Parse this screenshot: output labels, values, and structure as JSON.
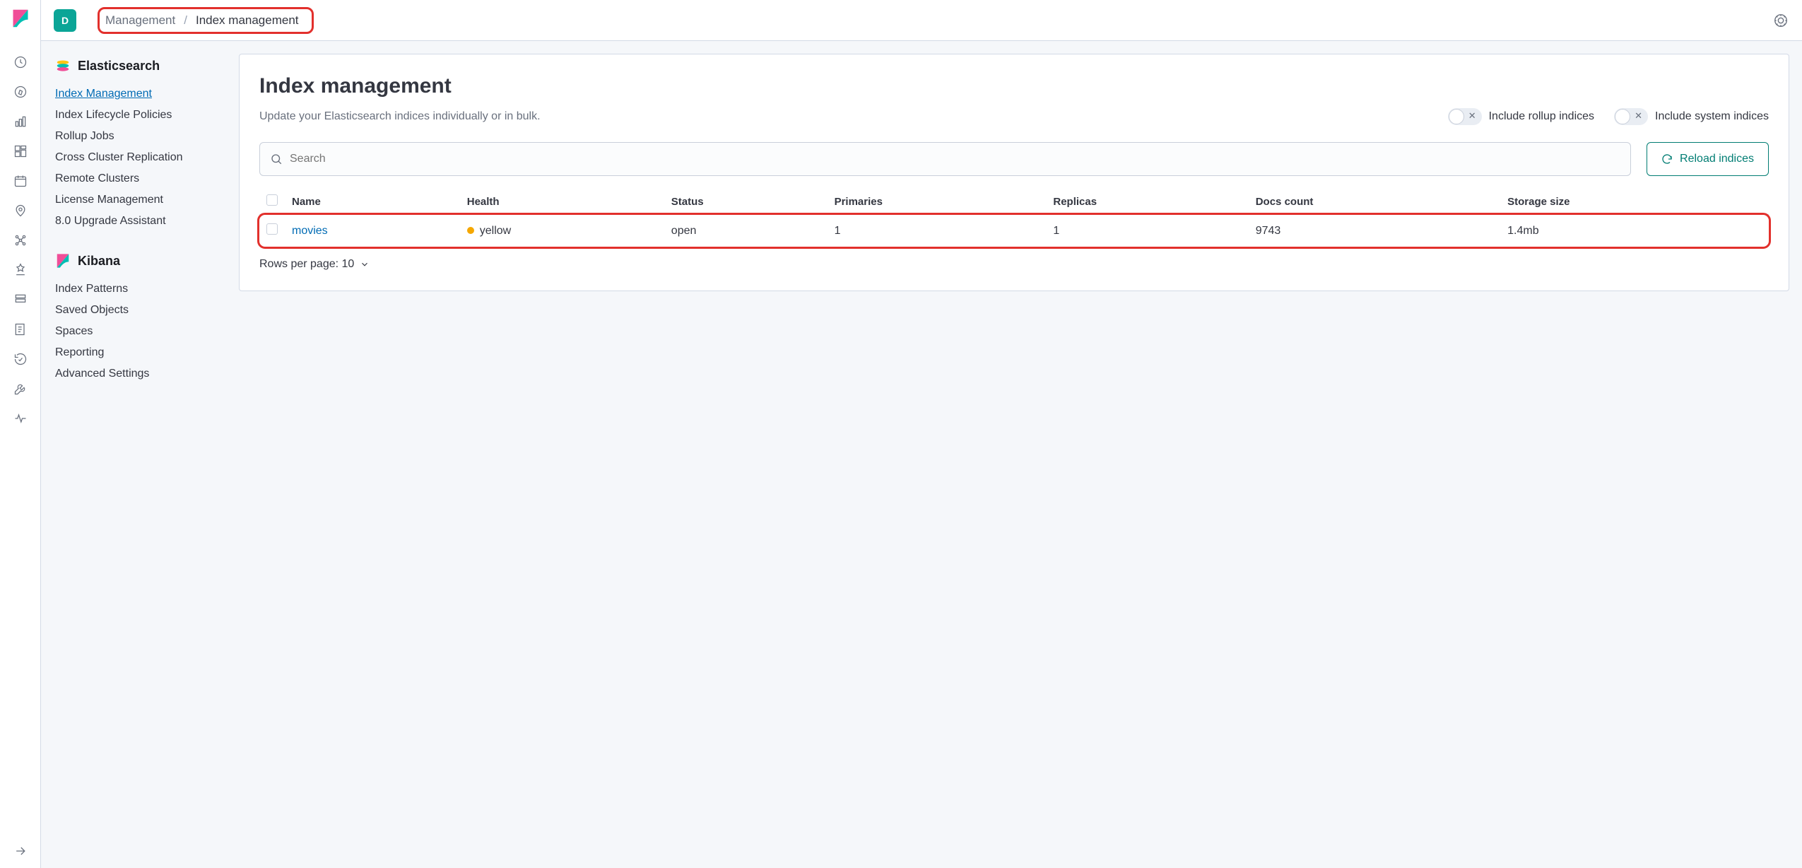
{
  "header": {
    "space_initial": "D",
    "breadcrumb": {
      "parent": "Management",
      "current": "Index management"
    }
  },
  "sidebar": {
    "sections": [
      {
        "title": "Elasticsearch",
        "items": [
          "Index Management",
          "Index Lifecycle Policies",
          "Rollup Jobs",
          "Cross Cluster Replication",
          "Remote Clusters",
          "License Management",
          "8.0 Upgrade Assistant"
        ],
        "active_index": 0
      },
      {
        "title": "Kibana",
        "items": [
          "Index Patterns",
          "Saved Objects",
          "Spaces",
          "Reporting",
          "Advanced Settings"
        ],
        "active_index": -1
      }
    ]
  },
  "main": {
    "title": "Index management",
    "subtitle": "Update your Elasticsearch indices individually or in bulk.",
    "toggles": {
      "rollup": "Include rollup indices",
      "system": "Include system indices"
    },
    "search_placeholder": "Search",
    "reload_label": "Reload indices",
    "columns": [
      "Name",
      "Health",
      "Status",
      "Primaries",
      "Replicas",
      "Docs count",
      "Storage size"
    ],
    "rows": [
      {
        "name": "movies",
        "health": "yellow",
        "status": "open",
        "primaries": "1",
        "replicas": "1",
        "docs": "9743",
        "storage": "1.4mb"
      }
    ],
    "pagination": "Rows per page: 10"
  }
}
